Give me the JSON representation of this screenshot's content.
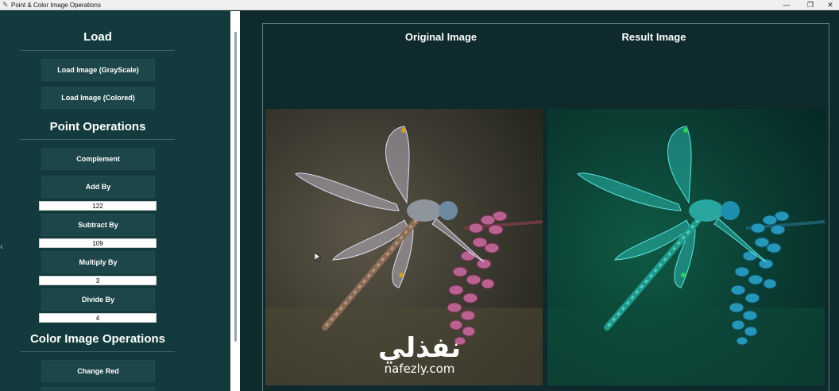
{
  "window": {
    "title": "Point & Color Image Operations",
    "controls": [
      "—",
      "❐",
      "✕"
    ]
  },
  "sections": {
    "load": "Load",
    "point_ops": "Point Operations",
    "color_ops": "Color Image Operations"
  },
  "buttons": {
    "load_gray": "Load Image (GrayScale)",
    "load_colored": "Load Image (Colored)",
    "complement": "Complement",
    "add_by": "Add By",
    "subtract_by": "Subtract By",
    "multiply_by": "Multiply By",
    "divide_by": "Divide By",
    "change_red": "Change Red"
  },
  "inputs": {
    "add_value": "122",
    "subtract_value": "109",
    "multiply_value": "3",
    "divide_value": "4"
  },
  "images": {
    "original_title": "Original Image",
    "result_title": "Result Image"
  },
  "watermark": {
    "arabic": "نفذلي",
    "domain": "nafezly.com"
  },
  "colors": {
    "panel_bg": "#133a3c",
    "main_bg": "#0e2a2c",
    "button_bg": "#1c4649",
    "text": "#ffffff"
  }
}
